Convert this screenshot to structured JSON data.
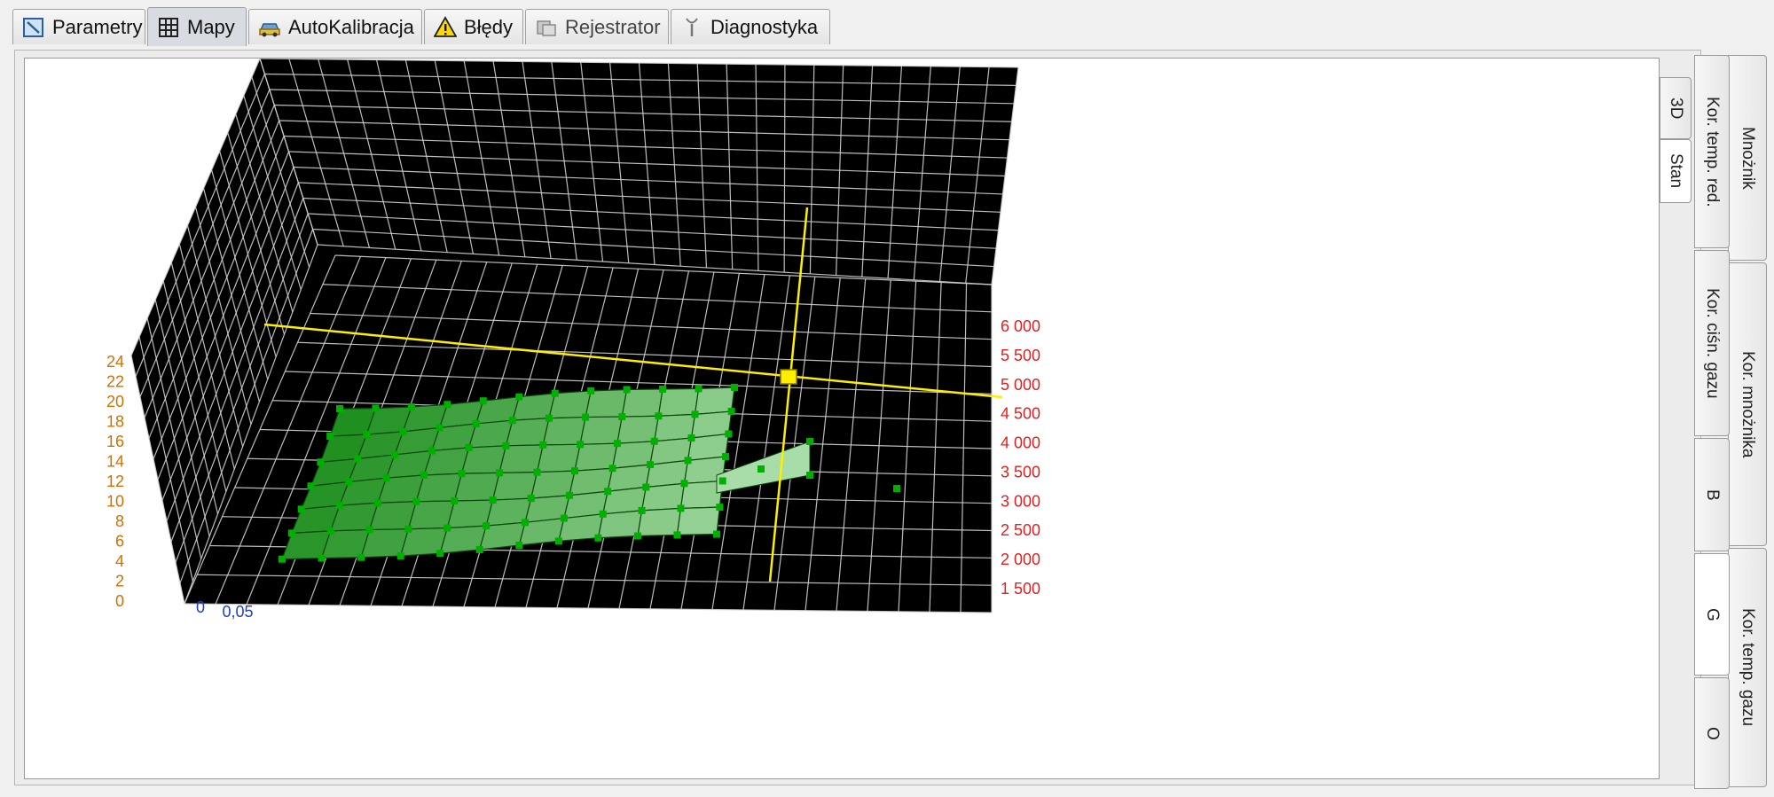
{
  "tabs": [
    {
      "label": "Parametry",
      "icon": "parameters-icon"
    },
    {
      "label": "Mapy",
      "icon": "grid-map-icon",
      "active": true
    },
    {
      "label": "AutoKalibracja",
      "icon": "car-icon"
    },
    {
      "label": "Błędy",
      "icon": "warning-icon"
    },
    {
      "label": "Rejestrator",
      "icon": "recorder-icon",
      "disabled": true
    },
    {
      "label": "Diagnostyka",
      "icon": "diagnostics-probe-icon"
    }
  ],
  "view_tabs": {
    "view3d": "3D",
    "stan": "Stan"
  },
  "map_tabs": {
    "mnoznik": "Mnożnik",
    "kor_mnoznika": "Kor. mnożnika",
    "kor_temp_gazu": "Kor. temp. gazu",
    "kor_temp_red": "Kor. temp. red.",
    "kor_cisn_gazu": "Kor. ciśn. gazu",
    "b": "B",
    "g": "G",
    "o": "O"
  },
  "chart_data": {
    "type": "surface3d",
    "left_axis_ticks": [
      "24",
      "22",
      "20",
      "18",
      "16",
      "14",
      "12",
      "10",
      "8",
      "6",
      "4",
      "2",
      "0"
    ],
    "right_axis_ticks": [
      "6 000",
      "5 500",
      "5 000",
      "4 500",
      "4 000",
      "3 500",
      "3 000",
      "2 500",
      "2 000",
      "1 500"
    ],
    "bottom_axis_ticks": [
      "0",
      "0,05"
    ],
    "colors": {
      "background": "#000000",
      "grid": "#d0d0d0",
      "surface_dark": "#1f8f1f",
      "surface_light": "#a8dca8",
      "points": "#00b000",
      "cursor": "#ffee00",
      "left_ticks": "#d07000",
      "right_ticks": "#e02020",
      "bottom_ticks": "#2040c0"
    }
  }
}
